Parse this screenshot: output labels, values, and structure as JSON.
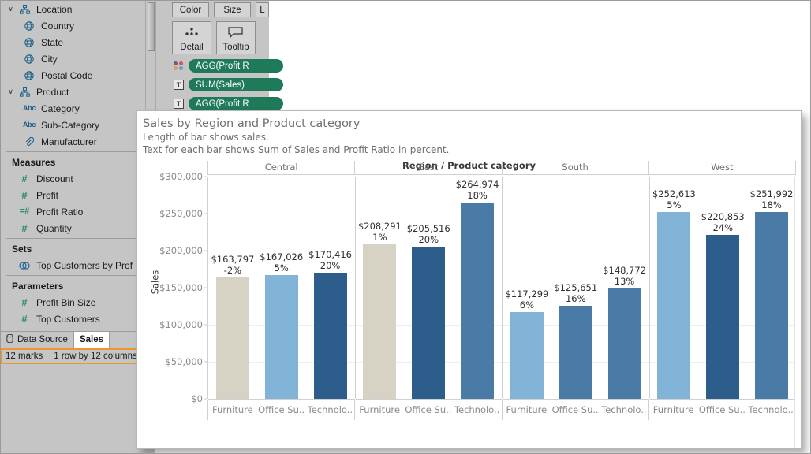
{
  "data_pane": {
    "items": [
      {
        "icon": "hierarchy-icon",
        "label": "Location",
        "kind": "folder",
        "indent": 0,
        "chevron": "⌄"
      },
      {
        "icon": "globe-icon",
        "label": "Country",
        "kind": "field",
        "indent": 1
      },
      {
        "icon": "globe-icon",
        "label": "State",
        "kind": "field",
        "indent": 1
      },
      {
        "icon": "globe-icon",
        "label": "City",
        "kind": "field",
        "indent": 1
      },
      {
        "icon": "globe-icon",
        "label": "Postal Code",
        "kind": "field",
        "indent": 1
      },
      {
        "icon": "hierarchy-icon",
        "label": "Product",
        "kind": "folder",
        "indent": 0,
        "chevron": "⌄"
      },
      {
        "icon": "abc-icon",
        "label": "Category",
        "kind": "field",
        "indent": 1,
        "abc": "Abc"
      },
      {
        "icon": "abc-icon",
        "label": "Sub-Category",
        "kind": "field",
        "indent": 1,
        "abc": "Abc"
      },
      {
        "icon": "paperclip-icon",
        "label": "Manufacturer",
        "kind": "field",
        "indent": 1
      }
    ],
    "sections": [
      {
        "title": "Measures",
        "items": [
          {
            "icon": "number-icon",
            "label": "Discount",
            "glyph": "#"
          },
          {
            "icon": "number-icon",
            "label": "Profit",
            "glyph": "#"
          },
          {
            "icon": "calculated-number-icon",
            "label": "Profit Ratio",
            "glyph": "=#"
          },
          {
            "icon": "number-icon",
            "label": "Quantity",
            "glyph": "#"
          }
        ]
      },
      {
        "title": "Sets",
        "items": [
          {
            "icon": "set-icon",
            "label": "Top Customers by Prof",
            "glyph": "◎"
          }
        ]
      },
      {
        "title": "Parameters",
        "items": [
          {
            "icon": "number-icon",
            "label": "Profit Bin Size",
            "glyph": "#"
          },
          {
            "icon": "number-icon",
            "label": "Top Customers",
            "glyph": "#"
          }
        ]
      }
    ]
  },
  "tabs": [
    {
      "label": "Data Source",
      "icon": "database-icon",
      "active": false
    },
    {
      "label": "Sales ",
      "icon": "",
      "active": true
    }
  ],
  "status_bar": {
    "marks": "12 marks",
    "dimensions": "1 row by 12 columns",
    "highlight_color": "#f0962c"
  },
  "marks_card": {
    "buttons_row1": [
      {
        "label": "Color",
        "name": "color-button"
      },
      {
        "label": "Size",
        "name": "size-button"
      },
      {
        "label": "L",
        "name": "label-button"
      }
    ],
    "buttons_row2": [
      {
        "label": "Detail",
        "name": "detail-button",
        "icon": "detail-dots-icon"
      },
      {
        "label": "Tooltip",
        "name": "tooltip-button",
        "icon": "tooltip-icon"
      }
    ],
    "pills": [
      {
        "label": "AGG(Profit R",
        "icon": "color-palette-icon"
      },
      {
        "label": "SUM(Sales)",
        "icon": "text-icon"
      },
      {
        "label": "AGG(Profit R",
        "icon": "text-icon"
      }
    ],
    "pill_color": "#1f7a5a"
  },
  "viz": {
    "title": "Sales by Region and Product category",
    "subtitle_1": "Length of bar shows sales.",
    "subtitle_2": "Text for each bar shows Sum of Sales and Profit Ratio in percent."
  },
  "chart_data": {
    "type": "bar",
    "title": "Sales by Region and Product category",
    "column_title": "Region / Product category",
    "xlabel": "Region / Product category",
    "ylabel": "Sales",
    "ylim": [
      0,
      300000
    ],
    "yticks": [
      0,
      50000,
      100000,
      150000,
      200000,
      250000,
      300000
    ],
    "ytick_labels": [
      "$0",
      "$50,000",
      "$100,000",
      "$150,000",
      "$200,000",
      "$250,000",
      "$300,000"
    ],
    "grid": true,
    "legend": "none",
    "regions": [
      "Central",
      "East",
      "South",
      "West"
    ],
    "categories": [
      "Furniture",
      "Office Su..",
      "Technolo.."
    ],
    "category_full": [
      "Furniture",
      "Office Supplies",
      "Technology"
    ],
    "bars": [
      {
        "region": "Central",
        "category": "Furniture",
        "sales": 163797,
        "sales_label": "$163,797",
        "profit_ratio": -2,
        "profit_label": "-2%",
        "color": "#d6d2c4"
      },
      {
        "region": "Central",
        "category": "Office Su..",
        "sales": 167026,
        "sales_label": "$167,026",
        "profit_ratio": 5,
        "profit_label": "5%",
        "color": "#82b4d8"
      },
      {
        "region": "Central",
        "category": "Technolo..",
        "sales": 170416,
        "sales_label": "$170,416",
        "profit_ratio": 20,
        "profit_label": "20%",
        "color": "#2d5d8a"
      },
      {
        "region": "East",
        "category": "Furniture",
        "sales": 208291,
        "sales_label": "$208,291",
        "profit_ratio": 1,
        "profit_label": "1%",
        "color": "#d6d2c4"
      },
      {
        "region": "East",
        "category": "Office Su..",
        "sales": 205516,
        "sales_label": "$205,516",
        "profit_ratio": 20,
        "profit_label": "20%",
        "color": "#2d5d8a"
      },
      {
        "region": "East",
        "category": "Technolo..",
        "sales": 264974,
        "sales_label": "$264,974",
        "profit_ratio": 18,
        "profit_label": "18%",
        "color": "#4a7ba7"
      },
      {
        "region": "South",
        "category": "Furniture",
        "sales": 117299,
        "sales_label": "$117,299",
        "profit_ratio": 6,
        "profit_label": "6%",
        "color": "#82b4d8"
      },
      {
        "region": "South",
        "category": "Office Su..",
        "sales": 125651,
        "sales_label": "$125,651",
        "profit_ratio": 16,
        "profit_label": "16%",
        "color": "#4a7ba7"
      },
      {
        "region": "South",
        "category": "Technolo..",
        "sales": 148772,
        "sales_label": "$148,772",
        "profit_ratio": 13,
        "profit_label": "13%",
        "color": "#4a7ba7"
      },
      {
        "region": "West",
        "category": "Furniture",
        "sales": 252613,
        "sales_label": "$252,613",
        "profit_ratio": 5,
        "profit_label": "5%",
        "color": "#82b4d8"
      },
      {
        "region": "West",
        "category": "Office Su..",
        "sales": 220853,
        "sales_label": "$220,853",
        "profit_ratio": 24,
        "profit_label": "24%",
        "color": "#2d5d8a"
      },
      {
        "region": "West",
        "category": "Technolo..",
        "sales": 251992,
        "sales_label": "$251,992",
        "profit_ratio": 18,
        "profit_label": "18%",
        "color": "#4a7ba7"
      }
    ]
  }
}
